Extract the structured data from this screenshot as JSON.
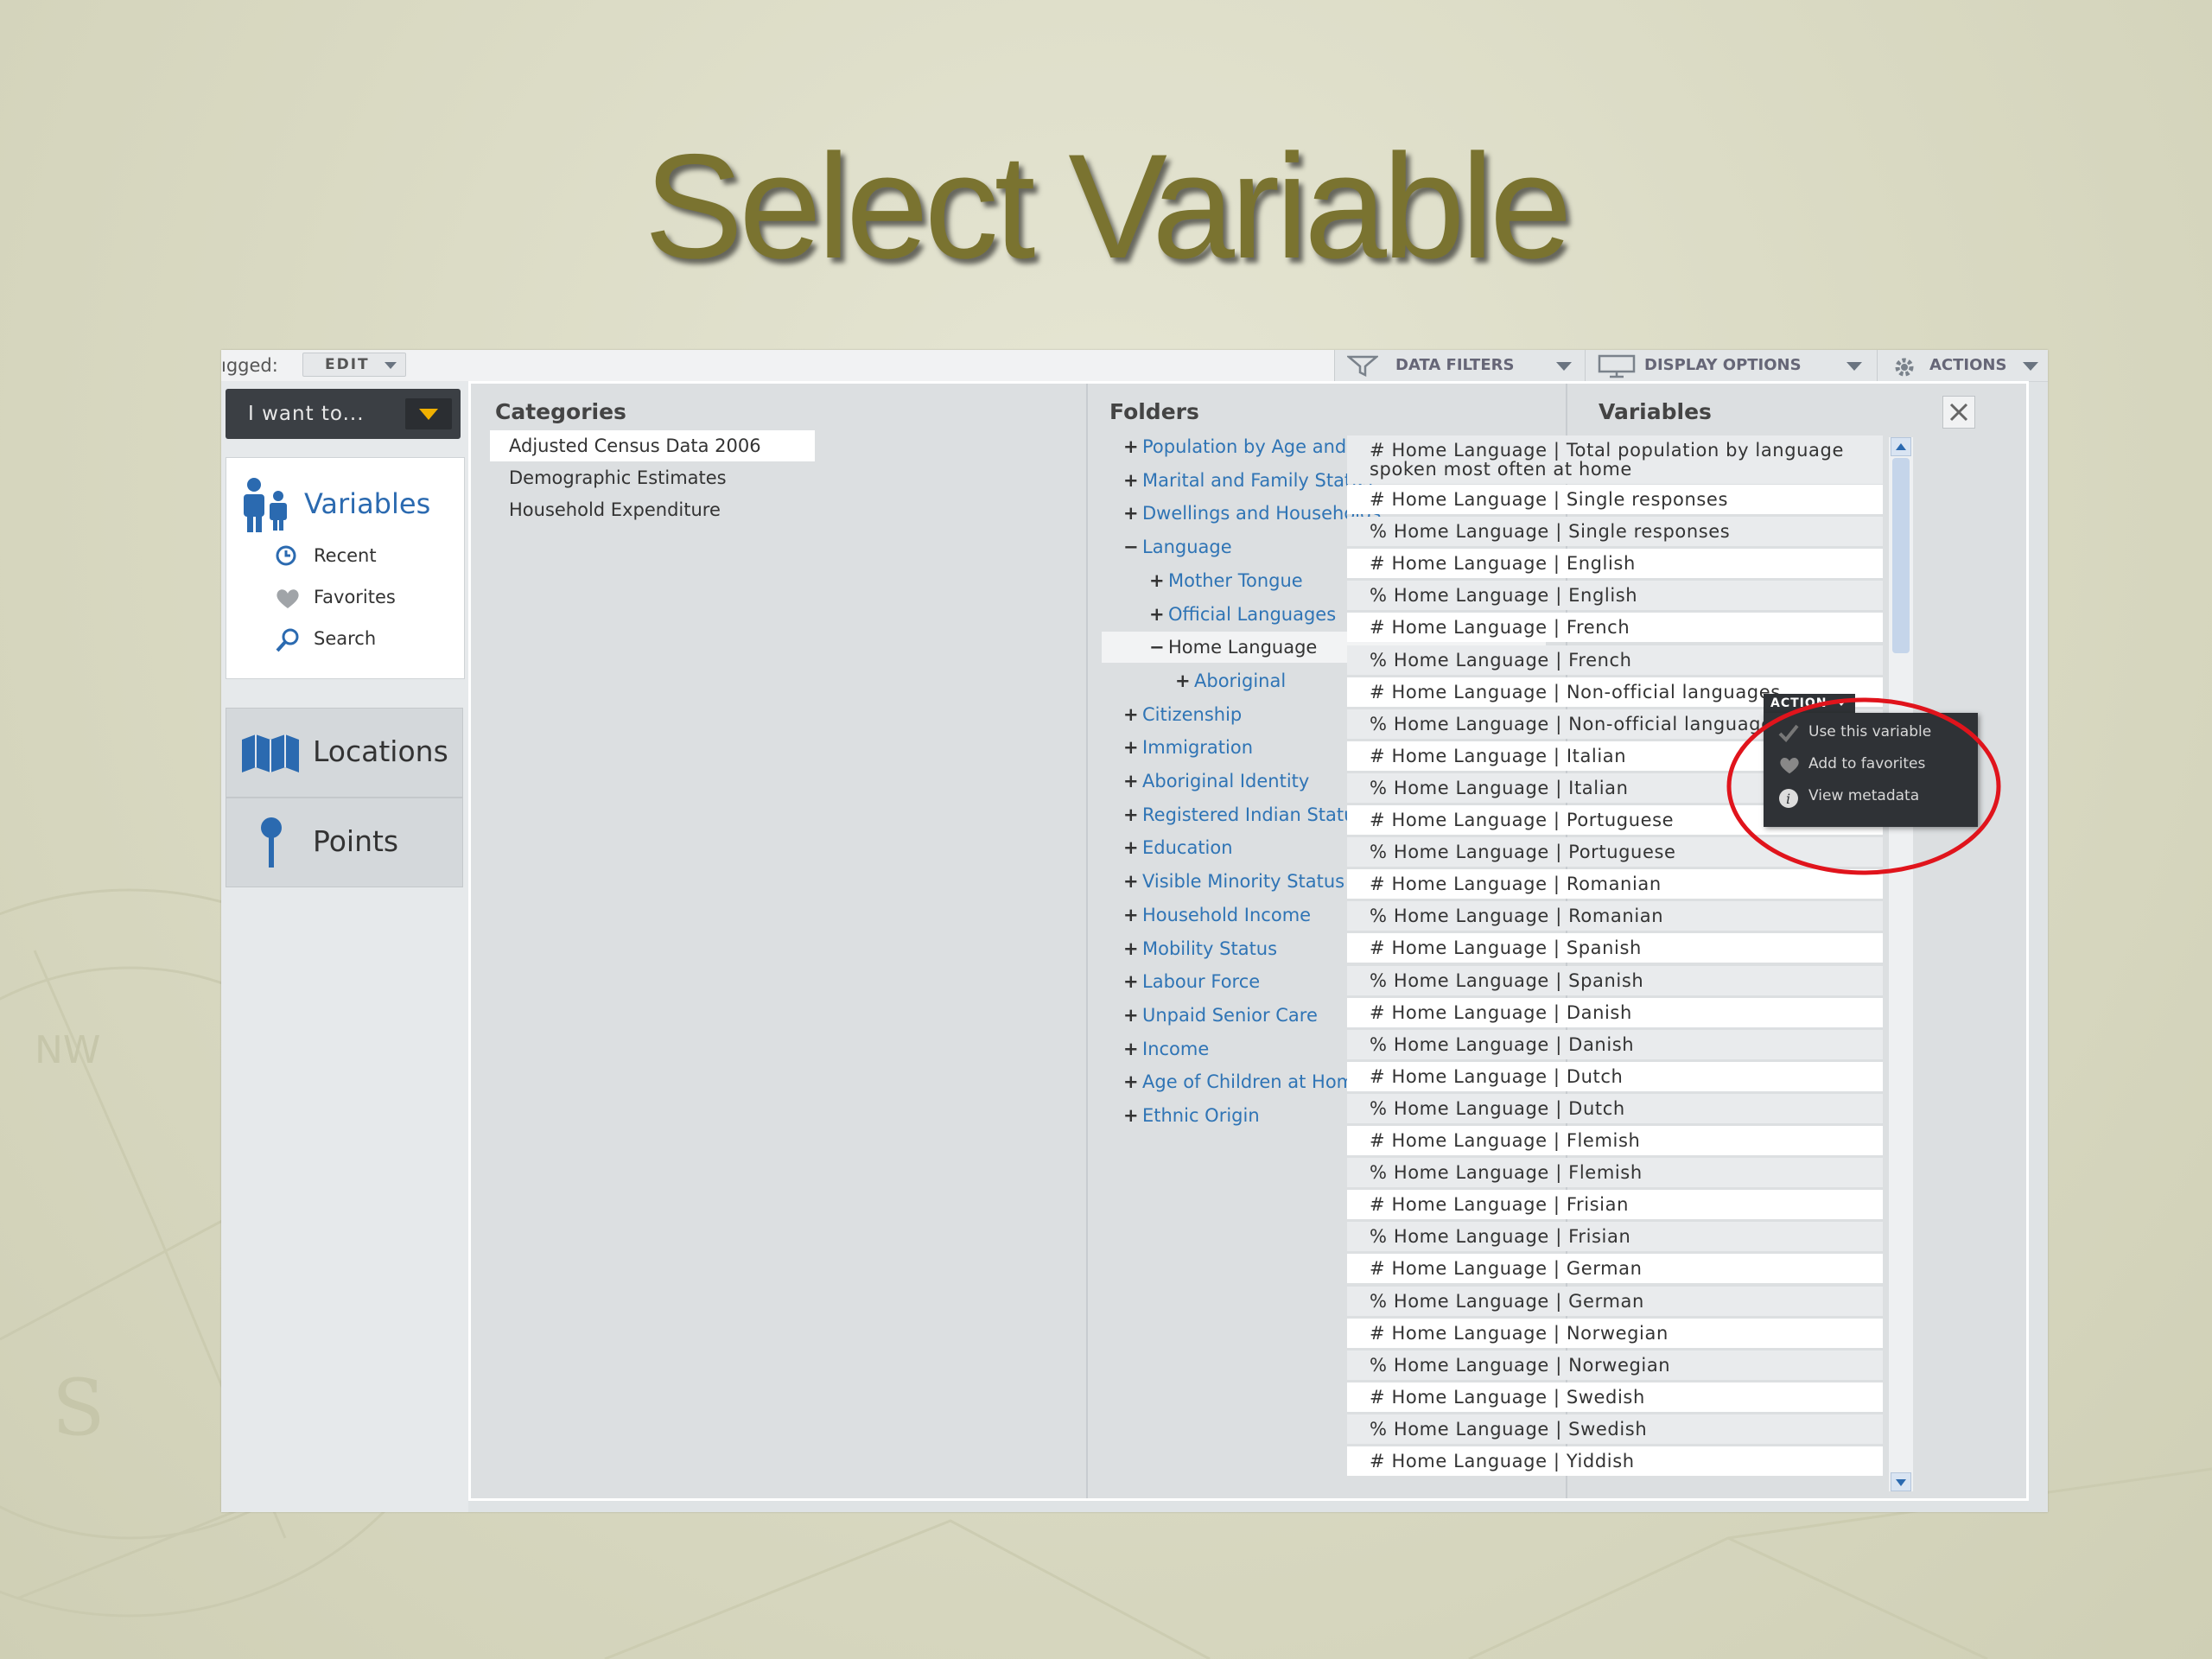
{
  "slide": {
    "title": "Select Variable"
  },
  "topbar": {
    "logged_label": "ıgged:",
    "edit_label": "EDIT",
    "data_filters": "DATA FILTERS",
    "display_options": "DISPLAY OPTIONS",
    "actions": "ACTIONS"
  },
  "leftnav": {
    "want_label": "I want to...",
    "variables": "Variables",
    "recent": "Recent",
    "favorites": "Favorites",
    "search": "Search",
    "locations": "Locations",
    "points": "Points"
  },
  "categories": {
    "header": "Categories",
    "items": [
      "Adjusted Census Data 2006",
      "Demographic Estimates",
      "Household Expenditure"
    ],
    "selected": "Adjusted Census Data 2006"
  },
  "folders": {
    "header": "Folders",
    "items": [
      {
        "label": "Population by Age and Sex",
        "sign": "+",
        "level": 0
      },
      {
        "label": "Marital and Family Status",
        "sign": "+",
        "level": 0
      },
      {
        "label": "Dwellings and Households",
        "sign": "+",
        "level": 0
      },
      {
        "label": "Language",
        "sign": "−",
        "level": 0
      },
      {
        "label": "Mother Tongue",
        "sign": "+",
        "level": 1
      },
      {
        "label": "Official Languages",
        "sign": "+",
        "level": 1
      },
      {
        "label": "Home Language",
        "sign": "−",
        "level": 1,
        "selected": true
      },
      {
        "label": "Aboriginal",
        "sign": "+",
        "level": 2
      },
      {
        "label": "Citizenship",
        "sign": "+",
        "level": 0
      },
      {
        "label": "Immigration",
        "sign": "+",
        "level": 0
      },
      {
        "label": "Aboriginal Identity",
        "sign": "+",
        "level": 0
      },
      {
        "label": "Registered Indian Status",
        "sign": "+",
        "level": 0
      },
      {
        "label": "Education",
        "sign": "+",
        "level": 0
      },
      {
        "label": "Visible Minority Status",
        "sign": "+",
        "level": 0
      },
      {
        "label": "Household Income",
        "sign": "+",
        "level": 0
      },
      {
        "label": "Mobility Status",
        "sign": "+",
        "level": 0
      },
      {
        "label": "Labour Force",
        "sign": "+",
        "level": 0
      },
      {
        "label": "Unpaid Senior Care",
        "sign": "+",
        "level": 0
      },
      {
        "label": "Income",
        "sign": "+",
        "level": 0
      },
      {
        "label": "Age of Children at Home",
        "sign": "+",
        "level": 0
      },
      {
        "label": "Ethnic Origin",
        "sign": "+",
        "level": 0
      }
    ]
  },
  "variables": {
    "header": "Variables",
    "first": "# Home Language | Total population by language spoken most often at home",
    "items": [
      "# Home Language | Single responses",
      "% Home Language | Single responses",
      "# Home Language | English",
      "% Home Language | English",
      "# Home Language | French",
      "% Home Language | French",
      "# Home Language | Non-official languages",
      "% Home Language | Non-official languages",
      "# Home Language | Italian",
      "% Home Language | Italian",
      "# Home Language | Portuguese",
      "% Home Language | Portuguese",
      "# Home Language | Romanian",
      "% Home Language | Romanian",
      "# Home Language | Spanish",
      "% Home Language | Spanish",
      "# Home Language | Danish",
      "% Home Language | Danish",
      "# Home Language | Dutch",
      "% Home Language | Dutch",
      "# Home Language | Flemish",
      "% Home Language | Flemish",
      "# Home Language | Frisian",
      "% Home Language | Frisian",
      "# Home Language | German",
      "% Home Language | German",
      "# Home Language | Norwegian",
      "% Home Language | Norwegian",
      "# Home Language | Swedish",
      "% Home Language | Swedish",
      "# Home Language | Yiddish"
    ]
  },
  "action_menu": {
    "tab": "ACTION",
    "use": "Use this variable",
    "favorite": "Add to favorites",
    "metadata": "View metadata"
  },
  "colors": {
    "title": "#7a7330",
    "link": "#2f74b5",
    "highlight_ring": "#e0141c"
  }
}
